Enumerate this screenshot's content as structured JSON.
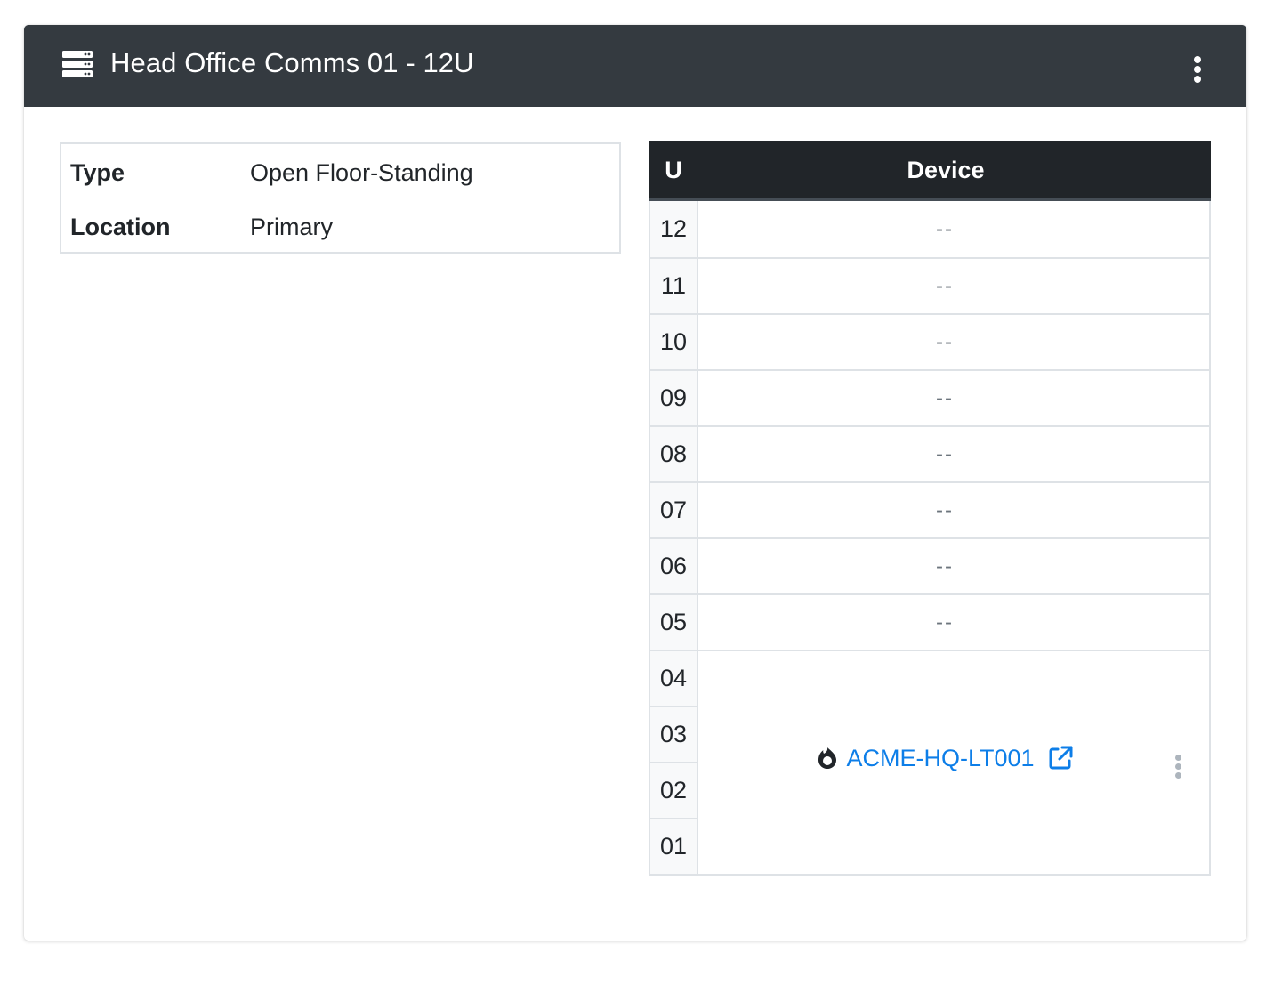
{
  "header": {
    "title": "Head Office Comms 01 - 12U",
    "icon": "server-icon",
    "menu_icon": "kebab-menu-icon"
  },
  "info": [
    {
      "key": "Type",
      "value": "Open Floor-Standing"
    },
    {
      "key": "Location",
      "value": "Primary"
    }
  ],
  "rack": {
    "columns": {
      "u": "U",
      "device": "Device"
    },
    "empty_rows": [
      {
        "u": "12",
        "device": "--"
      },
      {
        "u": "11",
        "device": "--"
      },
      {
        "u": "10",
        "device": "--"
      },
      {
        "u": "09",
        "device": "--"
      },
      {
        "u": "08",
        "device": "--"
      },
      {
        "u": "07",
        "device": "--"
      },
      {
        "u": "06",
        "device": "--"
      },
      {
        "u": "05",
        "device": "--"
      }
    ],
    "device_units": [
      "04",
      "03",
      "02",
      "01"
    ],
    "device": {
      "name": "ACME-HQ-LT001",
      "type_icon": "fire-icon",
      "link_icon": "external-link-icon",
      "menu_icon": "kebab-menu-icon"
    }
  },
  "colors": {
    "header_bg": "#343a40",
    "table_head_bg": "#212529",
    "link": "#0d7ee8",
    "border": "#dee2e6"
  }
}
